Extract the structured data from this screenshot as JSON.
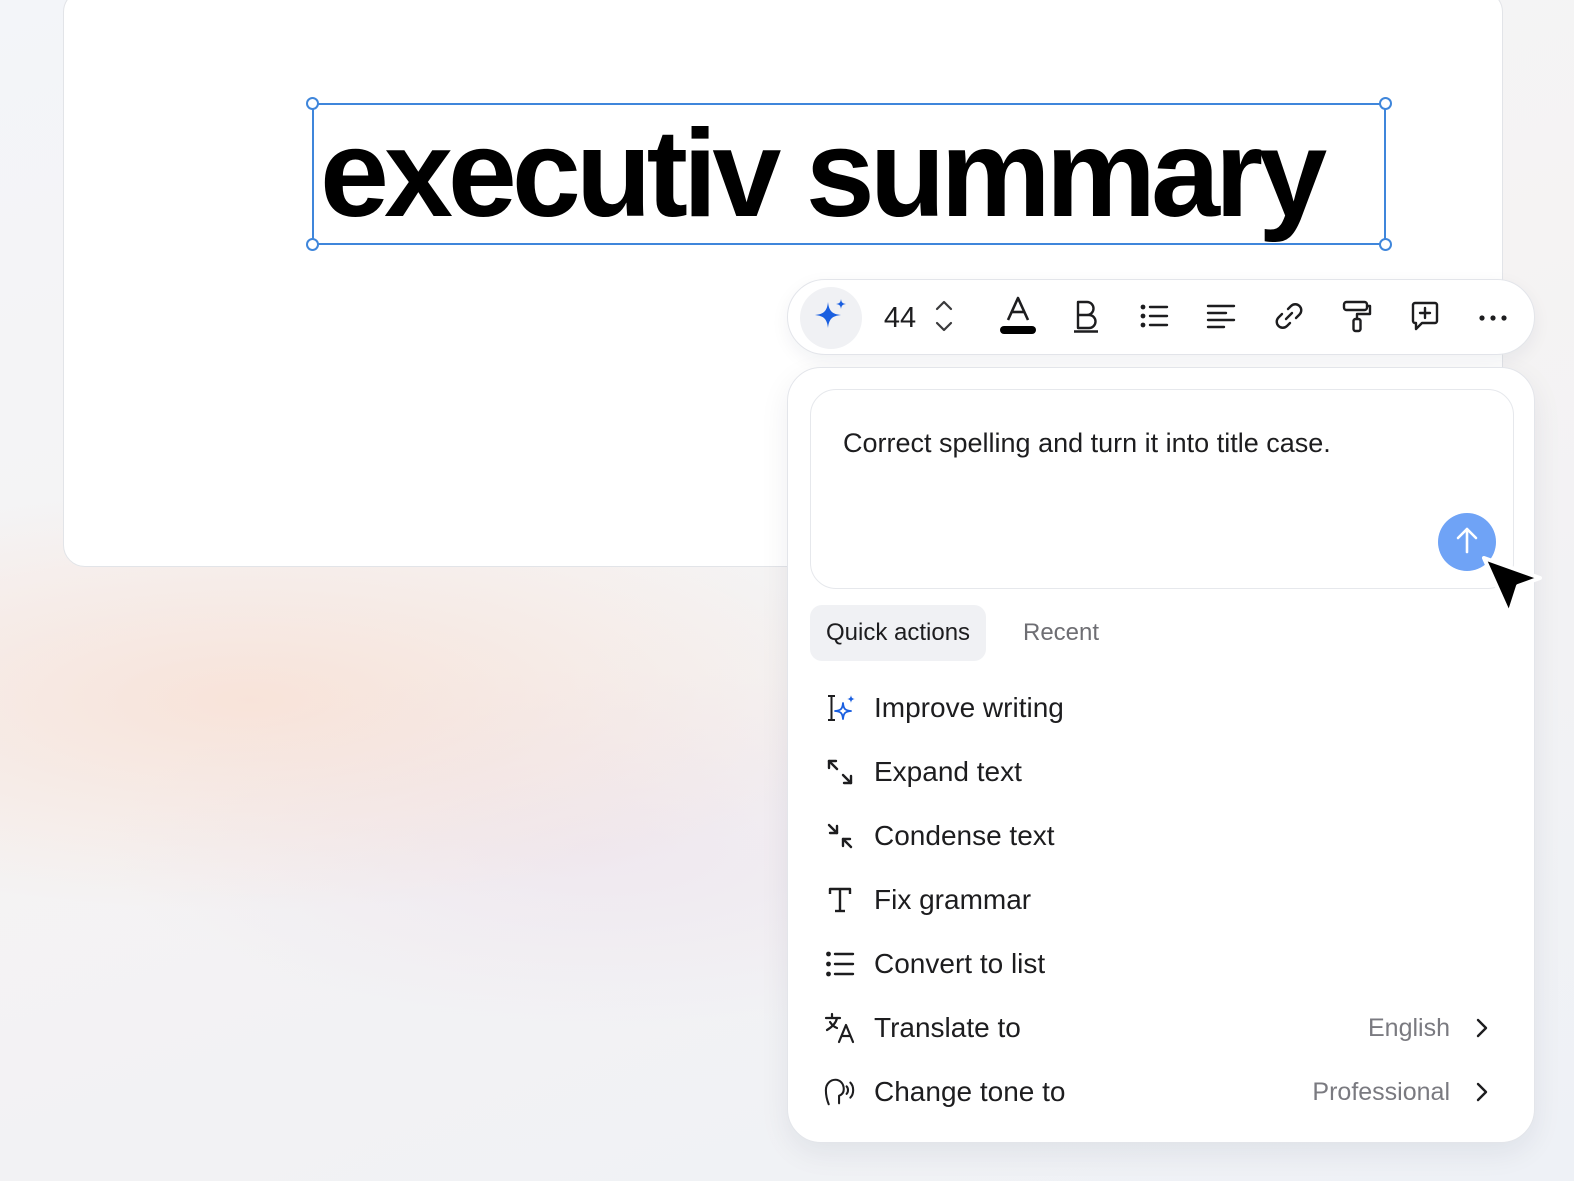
{
  "document": {
    "title_text": "executiv summary"
  },
  "toolbar": {
    "font_size": "44",
    "icons": [
      "ai-sparkle-icon",
      "stepper-icon",
      "text-color-icon",
      "bold-icon",
      "bullet-list-icon",
      "align-left-icon",
      "link-icon",
      "format-painter-icon",
      "add-comment-icon",
      "more-icon"
    ],
    "text_color": "#000000"
  },
  "ai_panel": {
    "prompt_value": "Correct spelling and turn it into title case.",
    "send_button_color": "#6fa3f6",
    "tabs": [
      {
        "label": "Quick actions",
        "active": true
      },
      {
        "label": "Recent",
        "active": false
      }
    ],
    "actions": [
      {
        "label": "Improve writing",
        "icon": "improve-writing-icon"
      },
      {
        "label": "Expand text",
        "icon": "expand-icon"
      },
      {
        "label": "Condense text",
        "icon": "condense-icon"
      },
      {
        "label": "Fix grammar",
        "icon": "text-t-icon"
      },
      {
        "label": "Convert to list",
        "icon": "list-icon"
      },
      {
        "label": "Translate to",
        "icon": "translate-icon",
        "value": "English"
      },
      {
        "label": "Change tone to",
        "icon": "tone-icon",
        "value": "Professional"
      }
    ]
  },
  "colors": {
    "selection": "#3f86db",
    "ai_accent": "#1a5fe0"
  }
}
